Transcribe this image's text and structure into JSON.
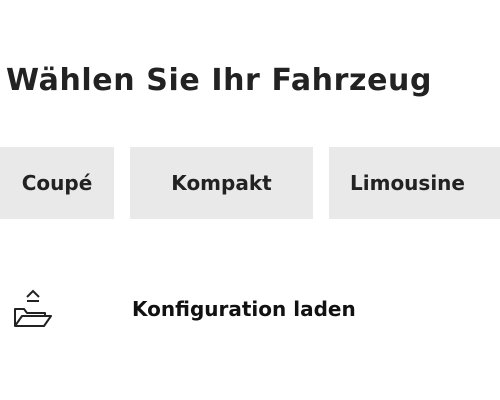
{
  "header": {
    "title": "Wählen Sie Ihr Fahrzeug"
  },
  "tabs": [
    {
      "label": "Coupé"
    },
    {
      "label": "Kompakt"
    },
    {
      "label": "Limousine"
    }
  ],
  "actions": {
    "load_config": {
      "label": "Konfiguration laden",
      "icon": "folder-open-icon"
    }
  },
  "colors": {
    "text": "#222222",
    "tab_background": "#e9e9e9",
    "page_background": "#ffffff"
  }
}
